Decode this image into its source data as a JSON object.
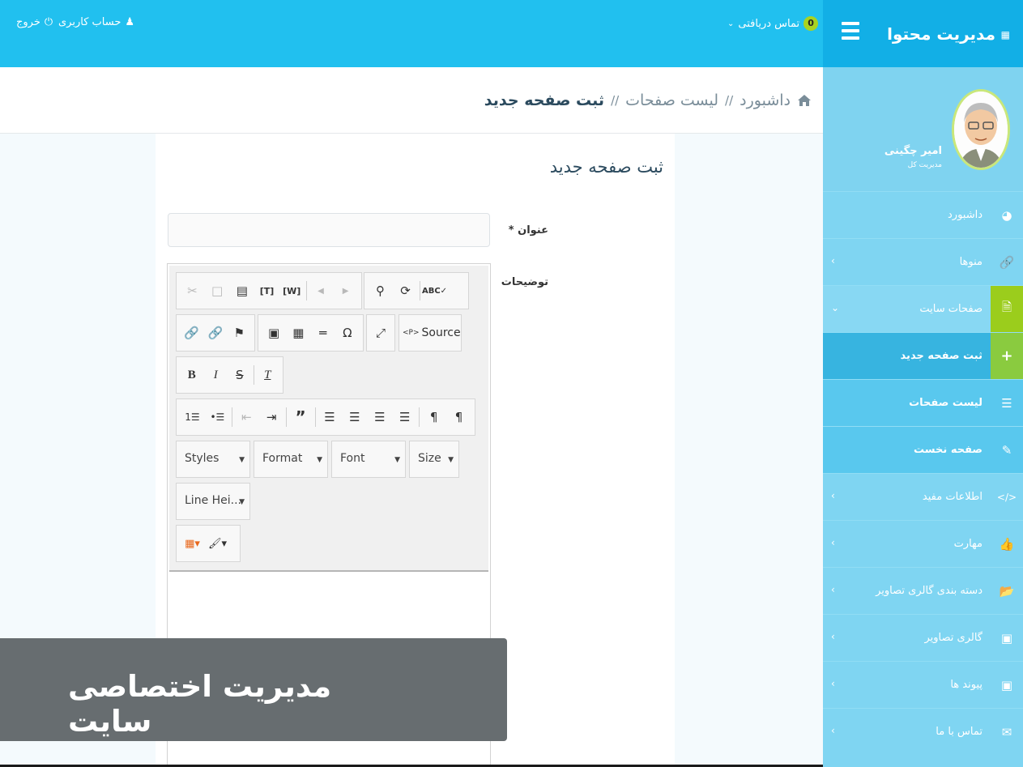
{
  "header": {
    "logout": "خروج",
    "account": "حساب کاربری",
    "messages_label": "تماس دریافتی",
    "messages_count": "0",
    "brand_title": "مدیریت محتوا"
  },
  "profile": {
    "name": "امیر چگینی",
    "role": "مدیریت کل"
  },
  "sidebar": {
    "items": [
      {
        "label": "داشبورد"
      },
      {
        "label": "منوها"
      },
      {
        "label": "صفحات سایت"
      },
      {
        "label": "ثبت صفحه جدید"
      },
      {
        "label": "لیست صفحات"
      },
      {
        "label": "صفحه نخست"
      },
      {
        "label": "اطلاعات مفید"
      },
      {
        "label": "مهارت"
      },
      {
        "label": "دسته بندی گالری تصاویر"
      },
      {
        "label": "گالری تصاویر"
      },
      {
        "label": "پیوند ها"
      },
      {
        "label": "تماس با ما"
      }
    ]
  },
  "breadcrumb": {
    "home": "داشبورد",
    "sep": "//",
    "list": "لیست صفحات",
    "current": "ثبت صفحه جدید"
  },
  "form": {
    "title": "ثبت صفحه جدید",
    "title_label": "عنوان *",
    "desc_label": "توضیحات"
  },
  "editor": {
    "source_label": "Source",
    "styles": "Styles",
    "format": "Format",
    "font": "Font",
    "size": "Size",
    "line_height": "Line Hei..."
  },
  "banner": {
    "text": "مدیریت اختصاصی سایت"
  },
  "colors": {
    "topbar": "#21c0ef",
    "brand": "#12afe6",
    "sidebar": "#7fd5f2",
    "accent_green": "#a8d321"
  }
}
